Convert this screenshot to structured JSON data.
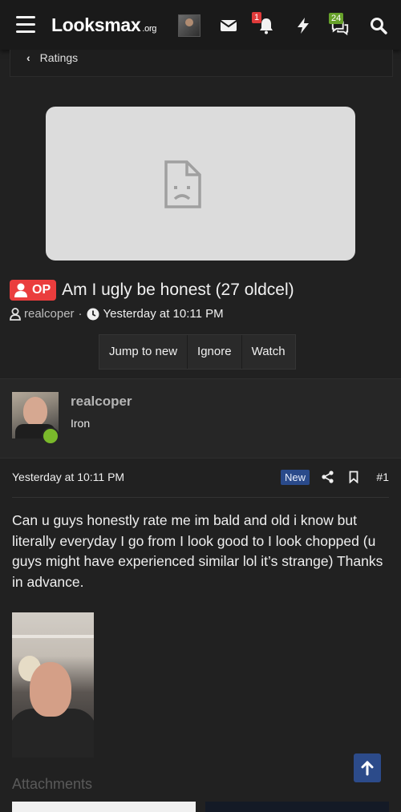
{
  "header": {
    "logo_text": "Looksmax",
    "logo_suffix": ".org",
    "alerts_count": "1",
    "conversations_count": "24",
    "alerts_badge_color": "#e03a3a",
    "conversations_badge_color": "#67a12a"
  },
  "breadcrumb": {
    "chevron": "‹",
    "label": "Ratings"
  },
  "thread": {
    "prefix": "OP",
    "title": "Am I ugly be honest (27 oldcel)",
    "author": "realcoper",
    "separator": "·",
    "date": "Yesterday at 10:11 PM"
  },
  "actions": {
    "jump": "Jump to new",
    "ignore": "Ignore",
    "watch": "Watch"
  },
  "user": {
    "name": "realcoper",
    "rank": "Iron"
  },
  "post": {
    "date": "Yesterday at 10:11 PM",
    "new_label": "New",
    "number": "#1",
    "body": "Can u guys honestly rate me im bald and old i know but literally everyday I go from I look good to I look chopped (u guys might have experienced similar lol it’s strange) Thanks in advance.",
    "attachments_label": "Attachments"
  },
  "colors": {
    "background": "#212121",
    "op_badge": "#ea3d3d",
    "new_badge": "#2a4a8a",
    "online": "#7ab92b"
  }
}
